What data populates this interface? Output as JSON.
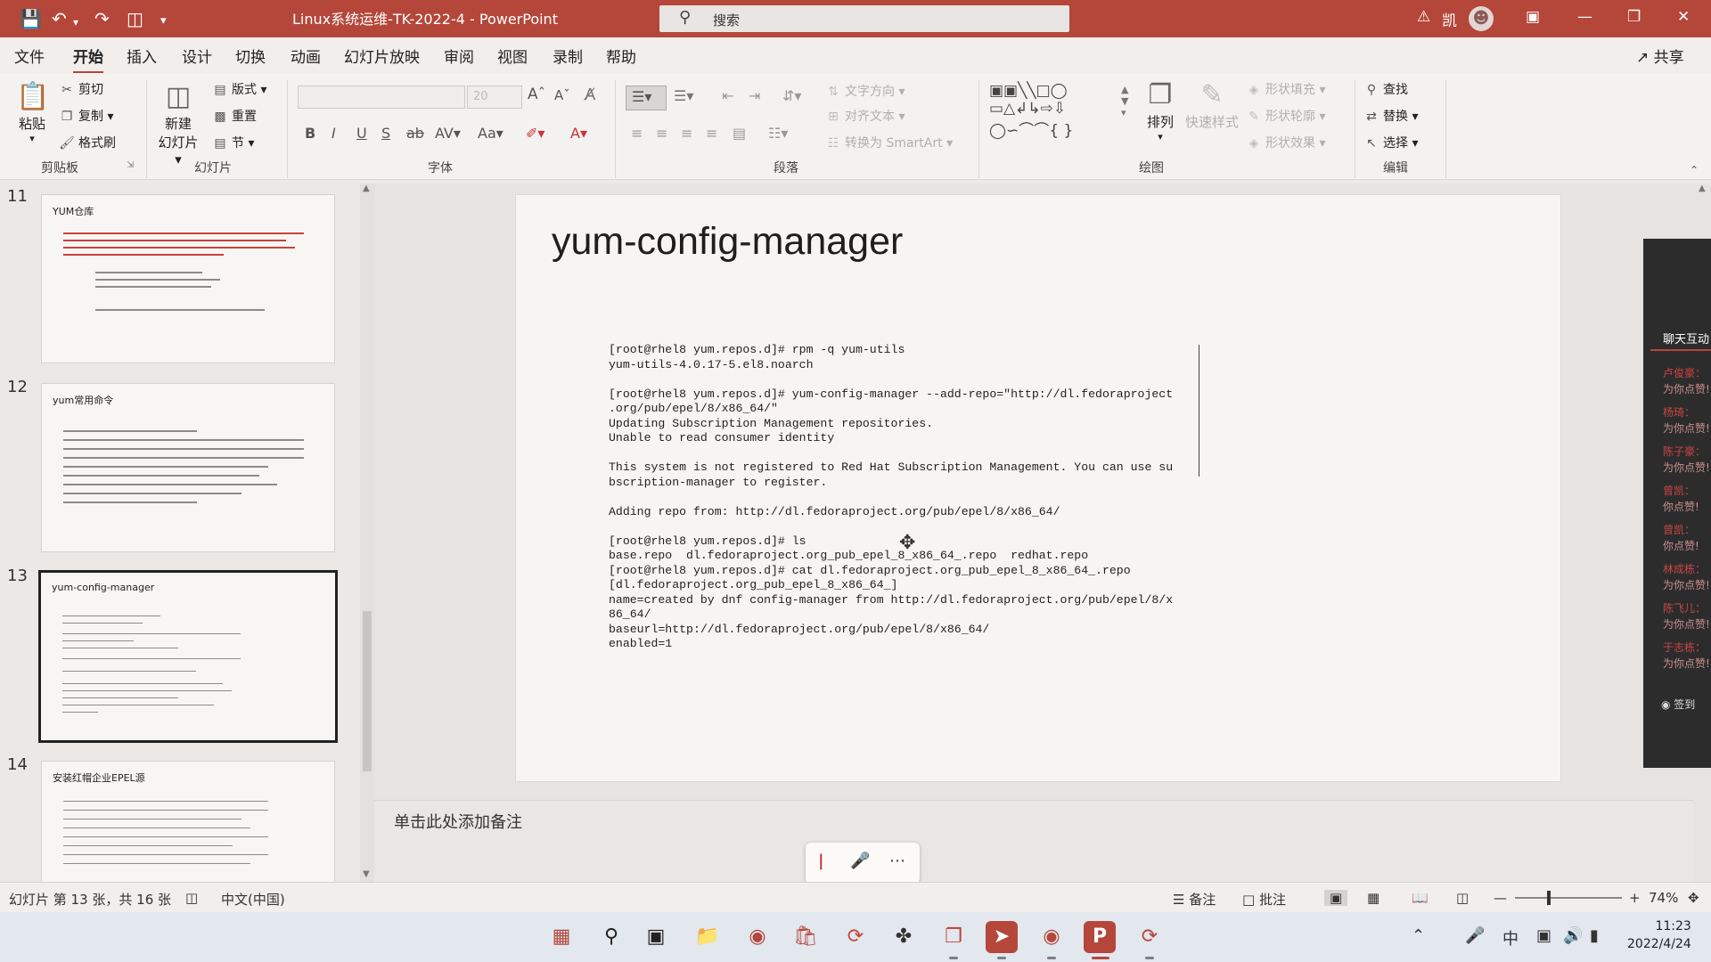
{
  "titlebar": {
    "doc_title": "Linux系统运维-TK-2022-4 - PowerPoint",
    "search_label": "搜索",
    "user_initial": "凯"
  },
  "menu": {
    "items": [
      "文件",
      "开始",
      "插入",
      "设计",
      "切换",
      "动画",
      "幻灯片放映",
      "审阅",
      "视图",
      "录制",
      "帮助"
    ],
    "active": "开始",
    "share": "共享"
  },
  "ribbon": {
    "clipboard": {
      "paste": "粘贴",
      "cut": "剪切",
      "copy": "复制",
      "format_painter": "格式刷",
      "label": "剪贴板"
    },
    "slides": {
      "new_slide": "新建",
      "new_slide2": "幻灯片",
      "layout": "版式",
      "reset": "重置",
      "section": "节",
      "label": "幻灯片"
    },
    "font": {
      "label": "字体",
      "size": "20"
    },
    "paragraph": {
      "text_direction": "文字方向",
      "align_text": "对齐文本",
      "smartart": "转换为 SmartArt",
      "label": "段落"
    },
    "drawing": {
      "arrange": "排列",
      "quick_styles": "快速样式",
      "shape_fill": "形状填充",
      "shape_outline": "形状轮廓",
      "shape_effects": "形状效果",
      "label": "绘图"
    },
    "editing": {
      "find": "查找",
      "replace": "替换",
      "select": "选择",
      "label": "编辑"
    }
  },
  "thumbnails": [
    {
      "num": "11",
      "title": "YUM仓库"
    },
    {
      "num": "12",
      "title": "yum常用命令"
    },
    {
      "num": "13",
      "title": "yum-config-manager",
      "selected": true
    },
    {
      "num": "14",
      "title": "安装红帽企业EPEL源"
    }
  ],
  "slide": {
    "title": "yum-config-manager",
    "code": "[root@rhel8 yum.repos.d]# rpm -q yum-utils\nyum-utils-4.0.17-5.el8.noarch\n\n[root@rhel8 yum.repos.d]# yum-config-manager --add-repo=\"http://dl.fedoraproject\n.org/pub/epel/8/x86_64/\"\nUpdating Subscription Management repositories.\nUnable to read consumer identity\n\nThis system is not registered to Red Hat Subscription Management. You can use su\nbscription-manager to register.\n\nAdding repo from: http://dl.fedoraproject.org/pub/epel/8/x86_64/\n\n[root@rhel8 yum.repos.d]# ls\nbase.repo  dl.fedoraproject.org_pub_epel_8_x86_64_.repo  redhat.repo\n[root@rhel8 yum.repos.d]# cat dl.fedoraproject.org_pub_epel_8_x86_64_.repo\n[dl.fedoraproject.org_pub_epel_8_x86_64_]\nname=created by dnf config-manager from http://dl.fedoraproject.org/pub/epel/8/x\n86_64/\nbaseurl=http://dl.fedoraproject.org/pub/epel/8/x86_64/\nenabled=1"
  },
  "notes": {
    "placeholder": "单击此处添加备注"
  },
  "chat_panel": {
    "heading": "聊天互动",
    "messages": [
      {
        "name": "卢俊豪：",
        "text": "为你点赞!"
      },
      {
        "name": "杨琦：",
        "text": "为你点赞!"
      },
      {
        "name": "陈子豪：",
        "text": "为你点赞!"
      },
      {
        "name": "曾凯：",
        "text": "你点赞!"
      },
      {
        "name": "曾凯：",
        "text": "你点赞!"
      },
      {
        "name": "林成栋：",
        "text": "为你点赞!"
      },
      {
        "name": "陈飞儿：",
        "text": "为你点赞!"
      },
      {
        "name": "于志栋：",
        "text": "为你点赞!"
      }
    ],
    "sign_in": "签到"
  },
  "statusbar": {
    "slide_info": "幻灯片 第 13 张，共 16 张",
    "language": "中文(中国)",
    "notes": "备注",
    "comments": "批注",
    "zoom": "74%"
  },
  "taskbar": {
    "ime": "中",
    "time": "11:23",
    "date": "2022/4/24"
  },
  "colors": {
    "accent": "#b5463a",
    "titlebar": "#b5463a"
  }
}
